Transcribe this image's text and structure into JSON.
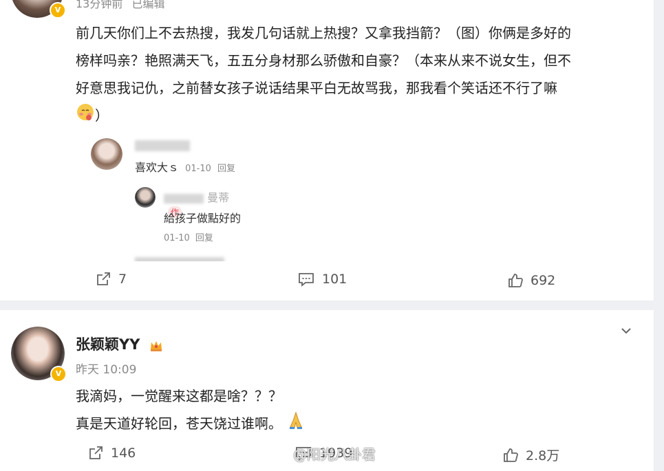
{
  "post1": {
    "time": "13分钟前",
    "edited": "已编辑",
    "text_lines": [
      "前几天你们上不去热搜，我发几句话就上热搜？又拿我挡箭？（图）你俩是多好的",
      "榜样吗亲？艳照满天飞，五五分身材那么骄傲和自豪？（本来从来不说女生，但不",
      "好意思我记仇，之前替女孩子说话结果平白无故骂我，那我看个笑话还不行了嘛"
    ],
    "text_tail": "）",
    "embed": {
      "comment1_text": "喜欢大ｓ",
      "comment1_date": "01-10",
      "comment1_reply": "回复",
      "reply_name": "曼蒂",
      "reply_tag": "作",
      "reply_text": "給孩子做點好的",
      "reply_date": "01-10",
      "reply_reply": "回复"
    },
    "reposts": "7",
    "comments": "101",
    "likes": "692"
  },
  "post2": {
    "username": "张颖颖YY",
    "time": "昨天 10:09",
    "line1": "我滴妈，一觉醒来这都是啥？？？",
    "line2": "真是天道好轮回，苍天饶过谁啊。",
    "reposts": "146",
    "comments": "1939",
    "likes": "2.8万",
    "watermark": "@阳光八卦君"
  },
  "colors": {
    "badge": "#f5b400",
    "accent_red": "#e0454e"
  }
}
